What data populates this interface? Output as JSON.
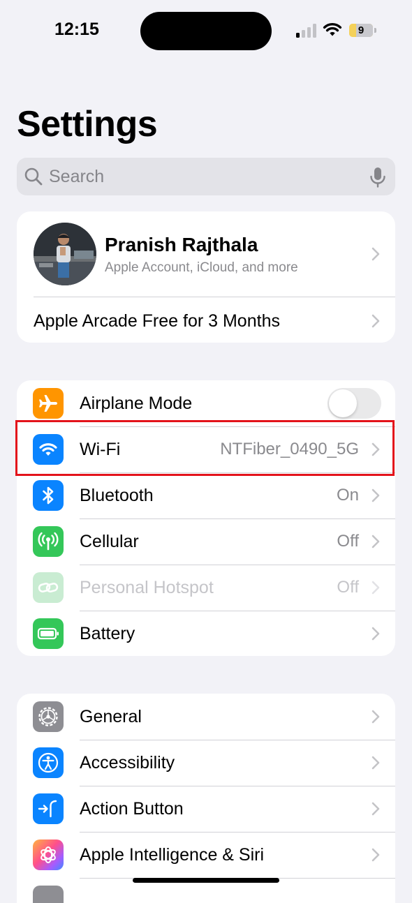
{
  "status_bar": {
    "time": "12:15",
    "battery_level": "9",
    "signal_bars_filled": 1,
    "signal_bars_total": 4
  },
  "page": {
    "title": "Settings"
  },
  "search": {
    "placeholder": "Search",
    "value": ""
  },
  "account": {
    "name": "Pranish Rajthala",
    "subtitle": "Apple Account, iCloud, and more",
    "promo": "Apple Arcade Free for 3 Months"
  },
  "connectivity": [
    {
      "id": "airplane",
      "label": "Airplane Mode",
      "value": "",
      "icon": "airplane-icon",
      "color": "#ff9500",
      "toggle": false
    },
    {
      "id": "wifi",
      "label": "Wi-Fi",
      "value": "NTFiber_0490_5G",
      "icon": "wifi-icon",
      "color": "#0a84ff"
    },
    {
      "id": "bluetooth",
      "label": "Bluetooth",
      "value": "On",
      "icon": "bluetooth-icon",
      "color": "#0a84ff"
    },
    {
      "id": "cellular",
      "label": "Cellular",
      "value": "Off",
      "icon": "antenna-icon",
      "color": "#34c759"
    },
    {
      "id": "hotspot",
      "label": "Personal Hotspot",
      "value": "Off",
      "icon": "hotspot-link-icon",
      "color": "#34c759",
      "disabled": true
    },
    {
      "id": "battery",
      "label": "Battery",
      "value": "",
      "icon": "battery-icon",
      "color": "#34c759"
    }
  ],
  "system": [
    {
      "id": "general",
      "label": "General",
      "icon": "gear-icon",
      "color": "#8e8e93"
    },
    {
      "id": "accessibility",
      "label": "Accessibility",
      "icon": "accessibility-person-icon",
      "color": "#0a84ff"
    },
    {
      "id": "action-button",
      "label": "Action Button",
      "icon": "action-button-icon",
      "color": "#0a84ff"
    },
    {
      "id": "apple-intelligence",
      "label": "Apple Intelligence & Siri",
      "icon": "apple-intelligence-icon",
      "color": "#ff5e9a"
    }
  ],
  "highlight": {
    "target": "wifi",
    "color": "#e3131b"
  }
}
